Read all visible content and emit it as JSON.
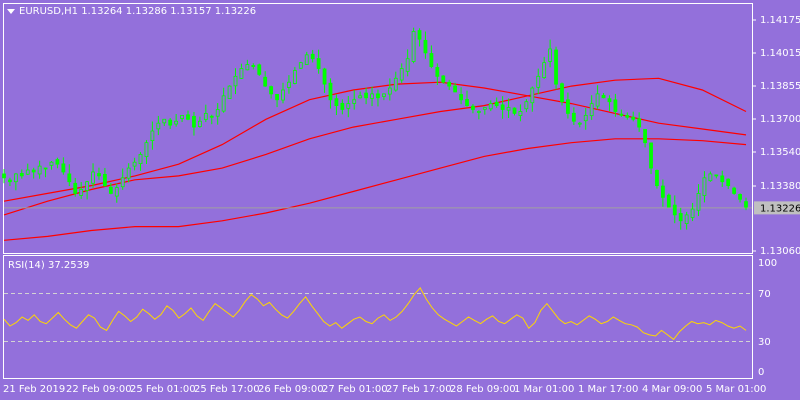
{
  "colors": {
    "background": "#9370DB",
    "text": "#ffffff",
    "candle_bull": "#00ff00",
    "candle_bear": "#00ff00",
    "ma": "#ff0000",
    "rsi_line": "#ffd700",
    "rsi_levels": "#d3d3d3",
    "current_price_line": "#a0a0a0",
    "current_price_tag": "#c0c0c0"
  },
  "header": {
    "arrow_icon": "triangle-down-icon",
    "title": "EURUSD,H1  1.13264 1.13286 1.13157 1.13226"
  },
  "price_axis": {
    "labels": [
      "1.14175",
      "1.14015",
      "1.13855",
      "1.13700",
      "1.13540",
      "1.13380",
      "1.13226",
      "1.13060"
    ],
    "current_price": "1.13226"
  },
  "rsi": {
    "title": "RSI(14) 37.2539",
    "axis_labels": [
      "100",
      "70",
      "30",
      "0"
    ]
  },
  "time_axis": {
    "labels": [
      "21 Feb 2019",
      "22 Feb 09:00",
      "25 Feb 01:00",
      "25 Feb 17:00",
      "26 Feb 09:00",
      "27 Feb 01:00",
      "27 Feb 17:00",
      "28 Feb 09:00",
      "1 Mar 01:00",
      "1 Mar 17:00",
      "4 Mar 09:00",
      "5 Mar 01:00"
    ]
  },
  "chart_data": [
    {
      "type": "candlestick",
      "symbol": "EURUSD",
      "timeframe": "H1",
      "ylim": [
        1.13,
        1.1425
      ],
      "close_series": [
        1.1338,
        1.1336,
        1.134,
        1.1339,
        1.1342,
        1.1341,
        1.1344,
        1.1343,
        1.1346,
        1.1345,
        1.1341,
        1.1336,
        1.133,
        1.1332,
        1.1336,
        1.1341,
        1.1339,
        1.1334,
        1.133,
        1.1333,
        1.1338,
        1.1343,
        1.1346,
        1.135,
        1.1356,
        1.1362,
        1.1366,
        1.1368,
        1.1365,
        1.1367,
        1.137,
        1.1368,
        1.1364,
        1.1367,
        1.1371,
        1.1369,
        1.1373,
        1.138,
        1.1385,
        1.139,
        1.1394,
        1.1396,
        1.1395,
        1.1391,
        1.1385,
        1.1381,
        1.1378,
        1.1383,
        1.1387,
        1.1393,
        1.1397,
        1.1401,
        1.1399,
        1.1394,
        1.1386,
        1.1378,
        1.1375,
        1.1373,
        1.1376,
        1.1378,
        1.138,
        1.1379,
        1.1381,
        1.1379,
        1.1381,
        1.1384,
        1.1389,
        1.1394,
        1.1399,
        1.1413,
        1.1409,
        1.1402,
        1.1395,
        1.139,
        1.1387,
        1.1385,
        1.1382,
        1.1378,
        1.1375,
        1.1373,
        1.1372,
        1.1374,
        1.1376,
        1.1375,
        1.1373,
        1.1374,
        1.1371,
        1.1372,
        1.1377,
        1.1384,
        1.139,
        1.1397,
        1.1404,
        1.1386,
        1.1377,
        1.1371,
        1.1367,
        1.1366,
        1.137,
        1.1376,
        1.1381,
        1.1379,
        1.1377,
        1.1372,
        1.137,
        1.1369,
        1.1368,
        1.1364,
        1.1356,
        1.1343,
        1.1334,
        1.1328,
        1.1323,
        1.1319,
        1.1316,
        1.1319,
        1.1322,
        1.133,
        1.1338,
        1.134,
        1.1339,
        1.1336,
        1.1334,
        1.133,
        1.1327,
        1.1323
      ],
      "moving_averages": [
        {
          "values": [
            1.1326,
            1.133,
            1.1334,
            1.1339,
            1.1345,
            1.1355,
            1.1368,
            1.1378,
            1.1383,
            1.1386,
            1.1387,
            1.1384,
            1.138,
            1.1376,
            1.1371,
            1.1366,
            1.1363,
            1.136
          ]
        },
        {
          "values": [
            1.1319,
            1.1326,
            1.1332,
            1.1337,
            1.1339,
            1.1343,
            1.135,
            1.1358,
            1.1364,
            1.1368,
            1.1372,
            1.1375,
            1.138,
            1.1385,
            1.1388,
            1.1389,
            1.1383,
            1.1372
          ]
        },
        {
          "values": [
            1.1306,
            1.1308,
            1.1311,
            1.1313,
            1.1313,
            1.1316,
            1.132,
            1.1325,
            1.1331,
            1.1337,
            1.1343,
            1.1349,
            1.1353,
            1.1356,
            1.1358,
            1.1358,
            1.1357,
            1.1355
          ]
        }
      ]
    },
    {
      "type": "line",
      "name": "RSI(14)",
      "ylim": [
        0,
        100
      ],
      "levels": [
        70,
        30
      ],
      "values": [
        48,
        42,
        45,
        50,
        47,
        52,
        46,
        44,
        49,
        54,
        48,
        43,
        40,
        46,
        52,
        49,
        41,
        38,
        47,
        55,
        51,
        46,
        50,
        57,
        53,
        48,
        52,
        60,
        56,
        49,
        53,
        58,
        51,
        47,
        55,
        62,
        58,
        54,
        50,
        56,
        64,
        70,
        66,
        60,
        63,
        57,
        52,
        49,
        55,
        62,
        68,
        60,
        53,
        46,
        42,
        45,
        40,
        44,
        48,
        50,
        46,
        44,
        49,
        52,
        47,
        50,
        55,
        62,
        70,
        76,
        66,
        58,
        52,
        48,
        45,
        42,
        46,
        50,
        47,
        44,
        48,
        51,
        46,
        44,
        48,
        52,
        49,
        40,
        45,
        56,
        62,
        55,
        48,
        44,
        46,
        43,
        47,
        51,
        48,
        44,
        46,
        50,
        47,
        44,
        43,
        41,
        36,
        34,
        33,
        38,
        34,
        30,
        37,
        42,
        46,
        44,
        45,
        43,
        47,
        45,
        42,
        40,
        42,
        38
      ]
    }
  ]
}
